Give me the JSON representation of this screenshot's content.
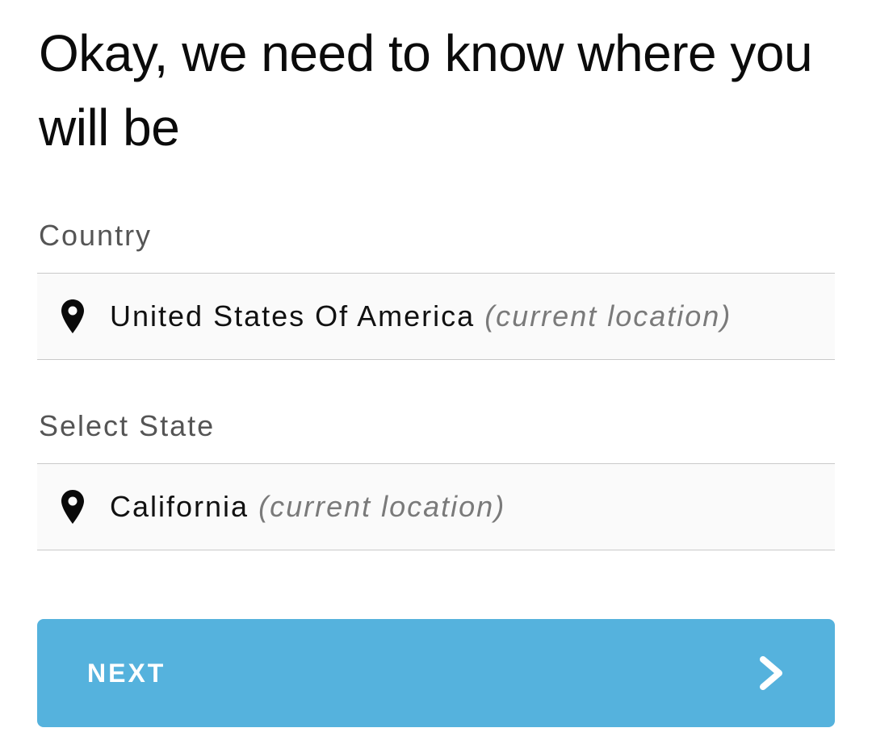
{
  "header": {
    "title": "Okay, we need to know where you will be"
  },
  "country": {
    "label": "Country",
    "value": "United States Of America",
    "hint": "(current location)",
    "icon": "location-pin-icon"
  },
  "state": {
    "label": "Select State",
    "value": "California",
    "hint": "(current location)",
    "icon": "location-pin-icon"
  },
  "next_button": {
    "label": "NEXT",
    "icon": "chevron-right-icon",
    "color": "#55b2dd"
  }
}
